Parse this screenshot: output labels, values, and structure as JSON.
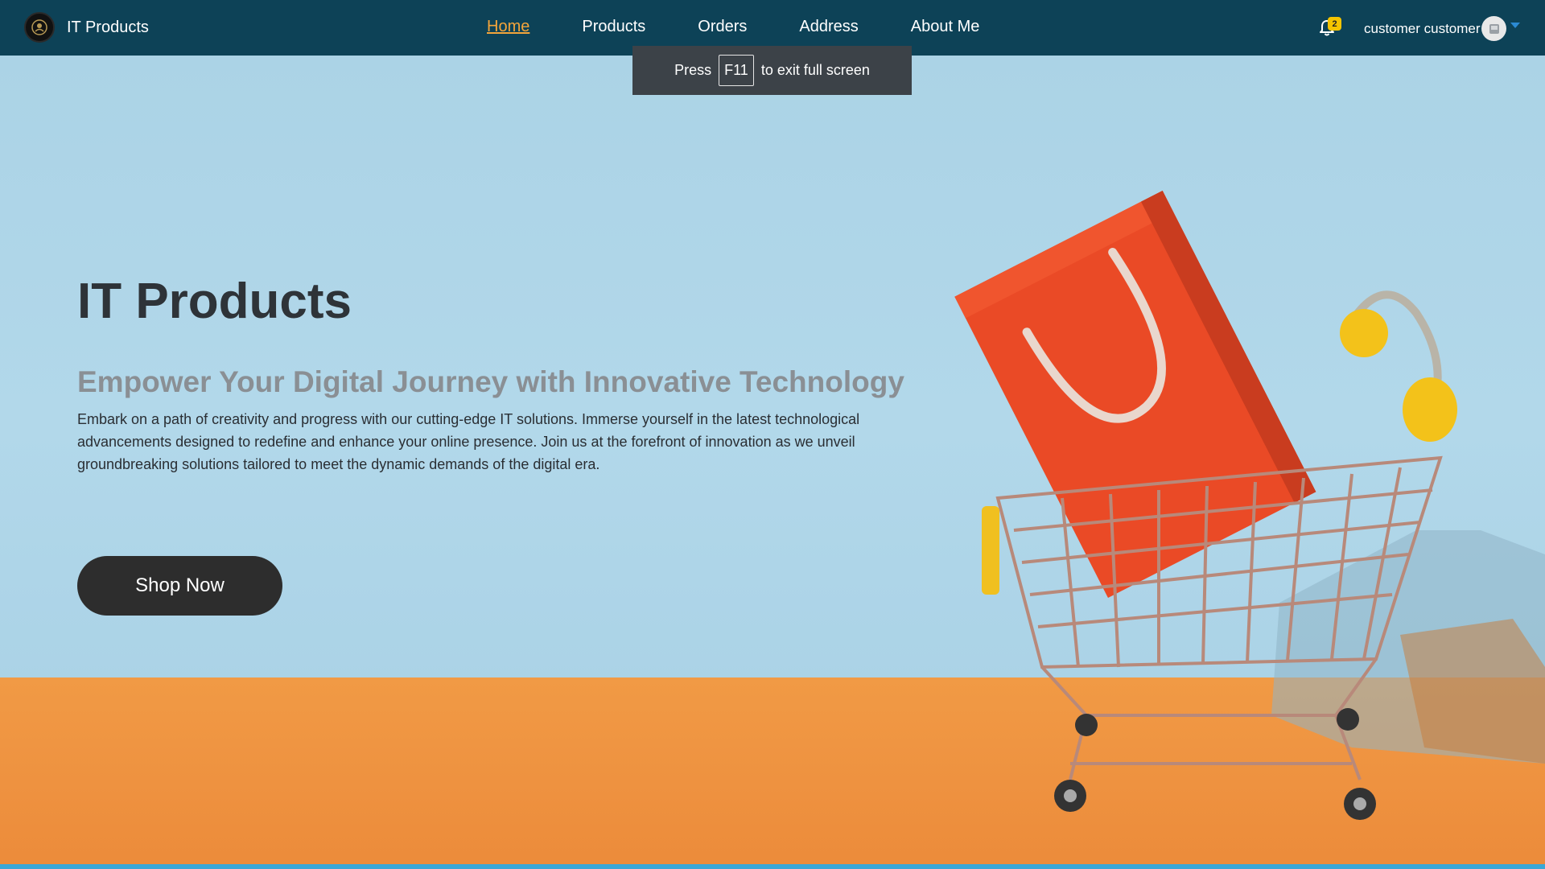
{
  "navbar": {
    "brand": "IT Products",
    "links": [
      "Home",
      "Products",
      "Orders",
      "Address",
      "About Me"
    ],
    "active_link": "Home",
    "notification_count": "2",
    "user_name": "customer customer"
  },
  "hero": {
    "title": "IT Products",
    "subtitle": "Empower Your Digital Journey with Innovative Technology",
    "description": "Embark on a path of creativity and progress with our cutting-edge IT solutions. Immerse yourself in the latest technological advancements designed to redefine and enhance your online presence. Join us at the forefront of innovation as we unveil groundbreaking solutions tailored to meet the dynamic demands of the digital era.",
    "cta": "Shop Now"
  },
  "fullscreen_toast": {
    "before": "Press",
    "key": "F11",
    "after": "to exit full screen"
  },
  "colors": {
    "navbar": "#0d4257",
    "active_link": "#f4a53a",
    "sky": "#abd3e6",
    "floor": "#ee9240",
    "button": "#2d2d2d"
  }
}
